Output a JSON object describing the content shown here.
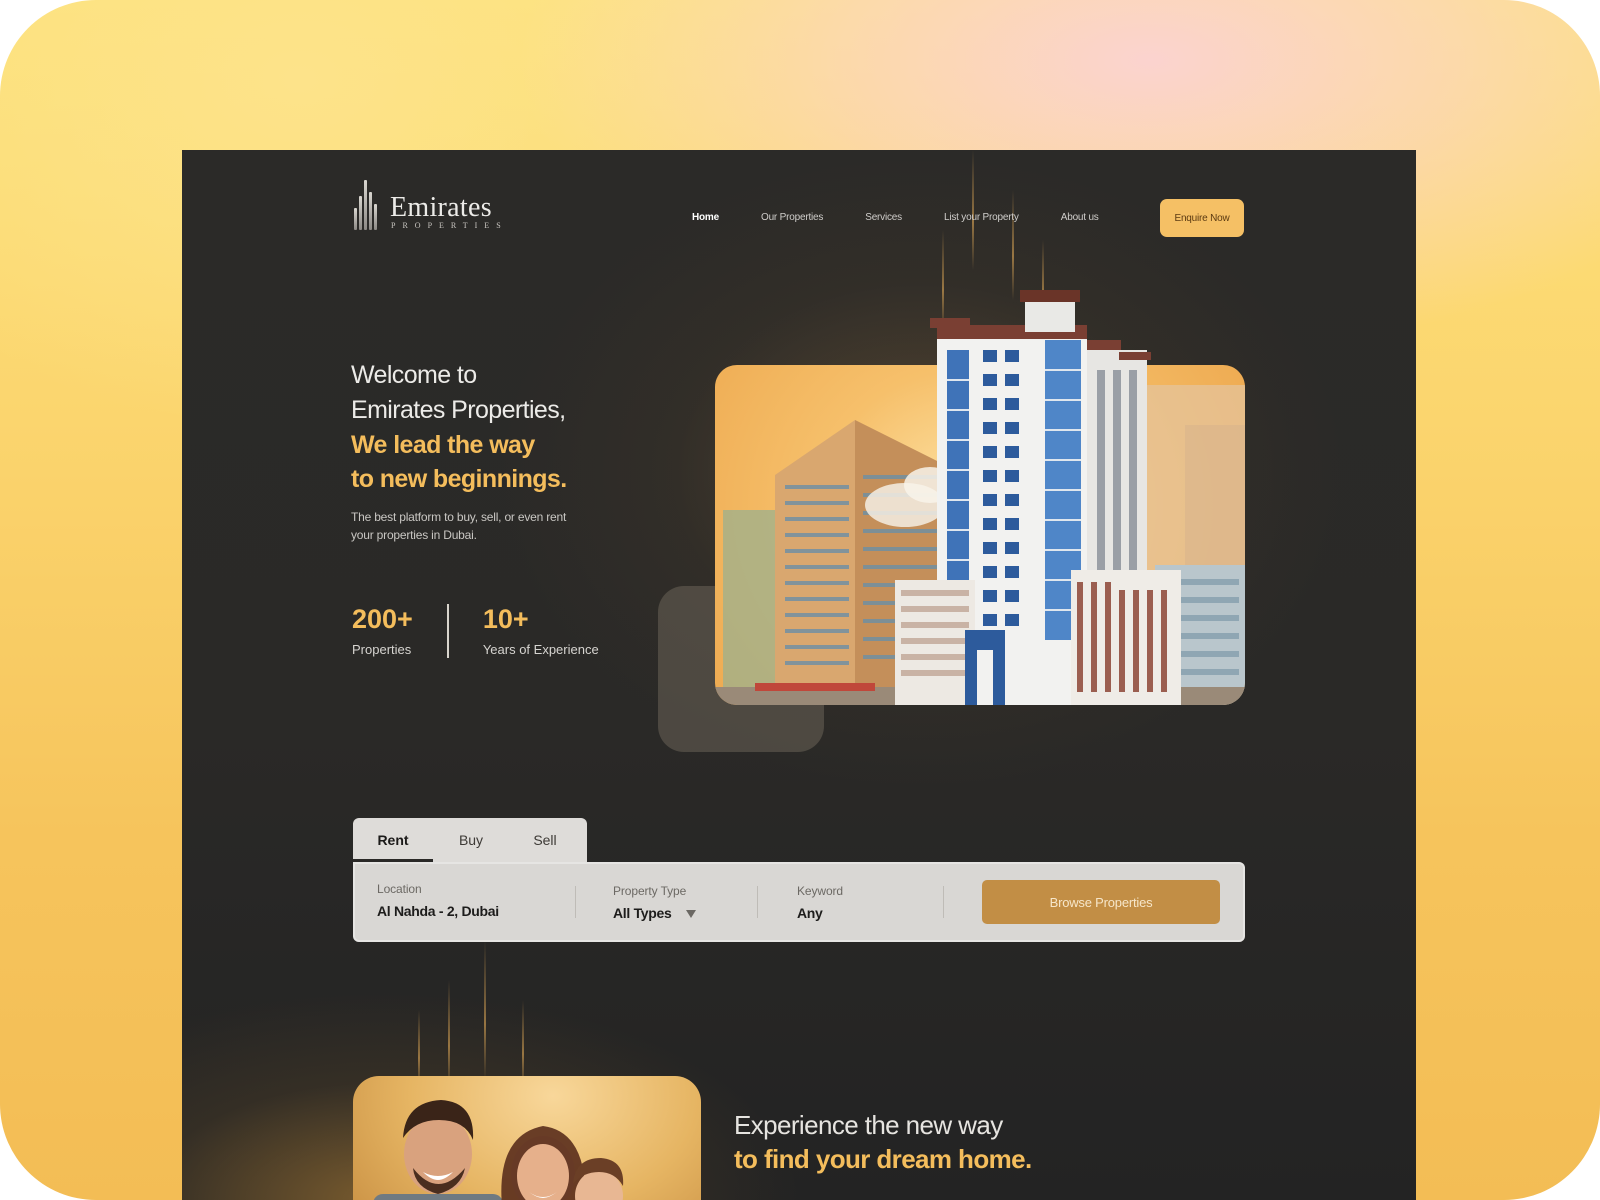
{
  "brand": {
    "name": "Emirates",
    "tagline": "PROPERTIES"
  },
  "nav": {
    "items": [
      {
        "label": "Home",
        "active": true
      },
      {
        "label": "Our Properties",
        "active": false
      },
      {
        "label": "Services",
        "active": false
      },
      {
        "label": "List your Property",
        "active": false
      },
      {
        "label": "About us",
        "active": false
      }
    ],
    "cta_label": "Enquire Now"
  },
  "hero": {
    "line1": "Welcome to",
    "line2": "Emirates Properties,",
    "accent1": "We lead the way",
    "accent2": "to new beginnings.",
    "subtitle": "The best platform to buy, sell, or even rent your properties in Dubai."
  },
  "stats": [
    {
      "value": "200+",
      "label": "Properties"
    },
    {
      "value": "10+",
      "label": "Years of Experience"
    }
  ],
  "search": {
    "tabs": [
      {
        "label": "Rent",
        "active": true
      },
      {
        "label": "Buy",
        "active": false
      },
      {
        "label": "Sell",
        "active": false
      }
    ],
    "location": {
      "label": "Location",
      "value": "Al Nahda - 2, Dubai"
    },
    "property_type": {
      "label": "Property Type",
      "value": "All Types"
    },
    "keyword": {
      "label": "Keyword",
      "value": "Any"
    },
    "button_label": "Browse Properties"
  },
  "experience": {
    "line1": "Experience the new way",
    "accent": "to find your dream home."
  },
  "colors": {
    "accent": "#f4bd5c",
    "button": "#c28e45",
    "background": "#2a2927"
  }
}
